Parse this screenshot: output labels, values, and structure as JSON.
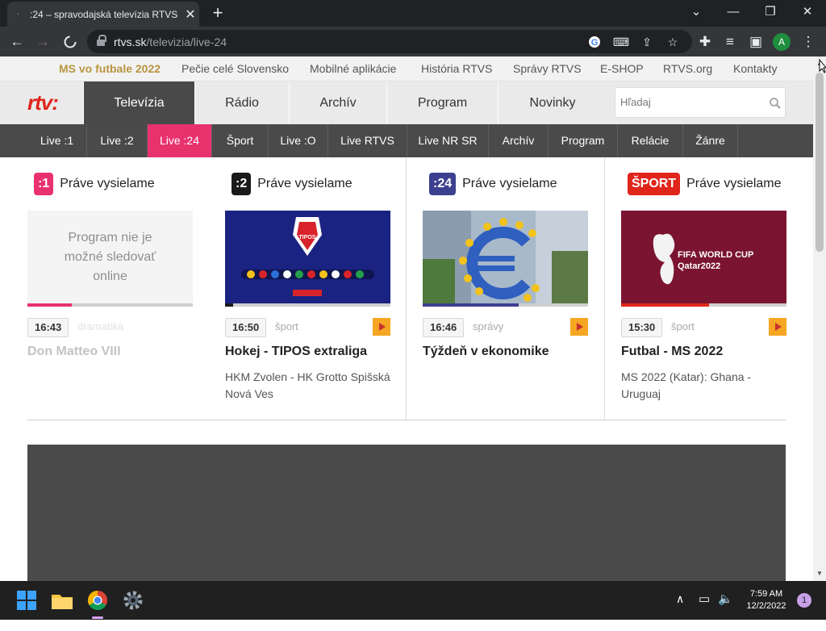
{
  "browser": {
    "tab_title": ":24 – spravodajská televízia RTVS",
    "tab_favicon": "·",
    "url_domain": "rtvs.sk",
    "url_path": "/televizia/live-24",
    "profile_initial": "A"
  },
  "site": {
    "top_links": [
      "MS vo futbale 2022",
      "Pečie celé Slovensko",
      "Mobilné aplikácie",
      "História RTVS",
      "Správy RTVS",
      "E-SHOP",
      "RTVS.org",
      "Kontakty"
    ],
    "logo": "rtv:",
    "main_nav": [
      "Televízia",
      "Rádio",
      "Archív",
      "Program",
      "Novinky"
    ],
    "search_placeholder": "Hľadaj",
    "sub_nav": [
      "Live :1",
      "Live :2",
      "Live :24",
      "Šport",
      "Live :O",
      "Live RTVS",
      "Live NR SR",
      "Archív",
      "Program",
      "Relácie",
      "Žánre"
    ],
    "accent_color": "#e8326e"
  },
  "channels": [
    {
      "badge": ":1",
      "badge_color": "#e8326e",
      "heading": "Práve vysielame",
      "thumb_text": "Program nie je možné sledovať online",
      "time": "16:43",
      "category": "dramatika",
      "title": "Don Matteo VIII",
      "description": "",
      "progress": 0.27
    },
    {
      "badge": ":2",
      "badge_color": "#1a1a1a",
      "heading": "Práve vysielame",
      "thumb_text": "TIPOS",
      "time": "16:50",
      "category": "šport",
      "title": "Hokej - TIPOS extraliga",
      "description": "HKM Zvolen - HK Grotto Spišská Nová Ves",
      "progress": 0.05
    },
    {
      "badge": ":24",
      "badge_color": "#3d3f8f",
      "heading": "Práve vysielame",
      "thumb_text": "",
      "time": "16:46",
      "category": "správy",
      "title": "Týždeň v ekonomike",
      "description": "",
      "progress": 0.58
    },
    {
      "badge": "ŠPORT",
      "badge_color": "#e0251b",
      "heading": "Práve vysielame",
      "thumb_text": "FIFA WORLD CUP Qatar2022",
      "time": "15:30",
      "category": "šport",
      "title": "Futbal - MS 2022",
      "description": "MS 2022 (Katar): Ghana - Uruguaj",
      "progress": 0.53
    }
  ],
  "taskbar": {
    "time": "7:59 AM",
    "date": "12/2/2022",
    "notification_count": "1"
  }
}
